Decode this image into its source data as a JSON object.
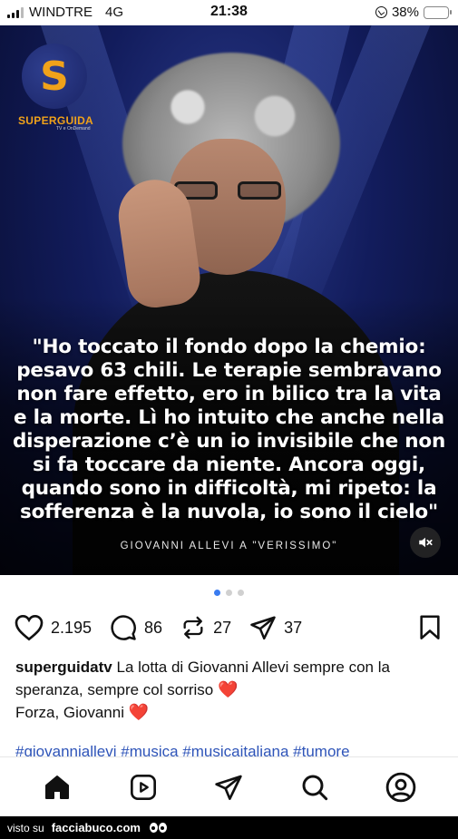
{
  "status_bar": {
    "carrier": "WINDTRE",
    "network": "4G",
    "time": "21:38",
    "battery_percent": "38%",
    "battery_level": 0.38,
    "battery_color": "#f4c430"
  },
  "post": {
    "logo_text": "SUPERGUIDA",
    "logo_subtext": "TV e OnDemand",
    "logo_letter": "S",
    "quote": "\"Ho toccato il fondo dopo la chemio: pesavo 63 chili. Le terapie sembravano non fare effetto, ero in bilico tra la vita e la morte. Lì ho intuito che anche nella disperazione c’è un io invisibile che non si fa toccare da niente. Ancora oggi, quando sono in difficoltà, mi ripeto: la sofferenza è la nuvola, io sono il cielo\"",
    "credit": "GIOVANNI ALLEVI A \"VERISSIMO\"",
    "mute_icon": "speaker-muted-icon",
    "carousel": {
      "count": 3,
      "active": 1,
      "active_color": "#3a7bf0"
    }
  },
  "actions": {
    "likes": "2.195",
    "comments": "86",
    "reposts": "27",
    "shares": "37"
  },
  "caption": {
    "username": "superguidatv",
    "text": "La lotta di Giovanni Allevi sempre con la speranza, sempre col sorriso",
    "heart1": "❤️",
    "line2": "Forza, Giovanni",
    "heart2": "❤️",
    "hashtags": "#giovanniallevi #musica #musicaitaliana #tumore"
  },
  "nav": [
    "home-icon",
    "reels-icon",
    "send-icon",
    "search-icon",
    "profile-icon"
  ],
  "footer": {
    "prefix": "visto su",
    "site": "facciabuco.com"
  }
}
